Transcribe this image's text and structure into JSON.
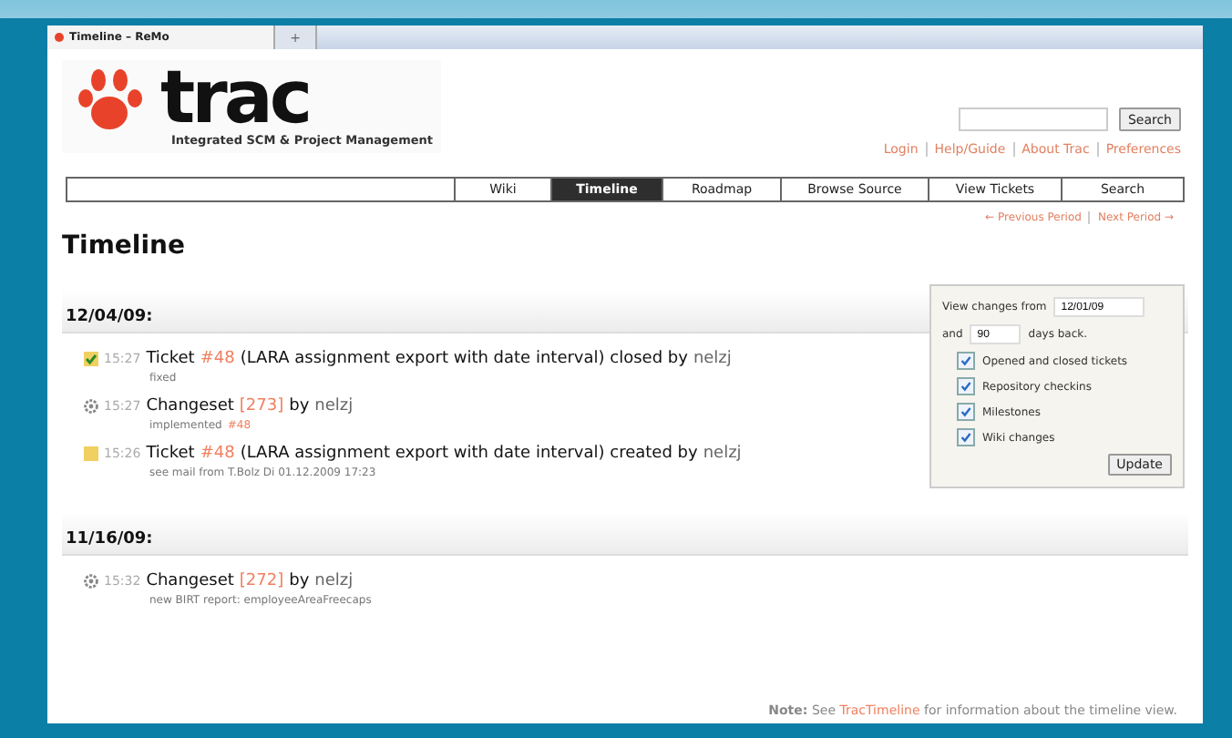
{
  "browser": {
    "tab_title": "Timeline – ReMo",
    "new_tab": "+"
  },
  "logo": {
    "name": "trac",
    "tagline": "Integrated SCM & Project Management"
  },
  "search": {
    "button": "Search"
  },
  "meta_nav": [
    "Login",
    "Help/Guide",
    "About Trac",
    "Preferences"
  ],
  "main_nav": [
    {
      "label": "Wiki",
      "selected": false
    },
    {
      "label": "Timeline",
      "selected": true
    },
    {
      "label": "Roadmap",
      "selected": false
    },
    {
      "label": "Browse Source",
      "selected": false
    },
    {
      "label": "View Tickets",
      "selected": false
    },
    {
      "label": "Search",
      "selected": false
    }
  ],
  "period_nav": {
    "previous": "← Previous Period",
    "next": "Next Period →"
  },
  "title": "Timeline",
  "days": [
    {
      "date": "12/04/09:",
      "events": [
        {
          "kind": "ticket-closed",
          "time": "15:27",
          "type_word": "Ticket",
          "ref": "#48",
          "summary": "(LARA assignment export with date interval) closed by",
          "author": "nelzj",
          "description": "fixed"
        },
        {
          "kind": "changeset",
          "time": "15:27",
          "type_word": "Changeset",
          "ref": "[273]",
          "summary": "by",
          "author": "nelzj",
          "description": "implemented",
          "description_ref": "#48"
        },
        {
          "kind": "ticket-created",
          "time": "15:26",
          "type_word": "Ticket",
          "ref": "#48",
          "summary": "(LARA assignment export with date interval) created by",
          "author": "nelzj",
          "description": "see mail from T.Bolz Di 01.12.2009 17:23"
        }
      ]
    },
    {
      "date": "11/16/09:",
      "events": [
        {
          "kind": "changeset",
          "time": "15:32",
          "type_word": "Changeset",
          "ref": "[272]",
          "summary": "by",
          "author": "nelzj",
          "description": "new BIRT report: employeeAreaFreecaps"
        }
      ]
    }
  ],
  "filters": {
    "from_label": "View changes from",
    "from_value": "12/01/09",
    "and_label": "and",
    "days_value": "90",
    "days_label": "days back.",
    "options": [
      {
        "label": "Opened and closed tickets",
        "checked": true
      },
      {
        "label": "Repository checkins",
        "checked": true
      },
      {
        "label": "Milestones",
        "checked": true
      },
      {
        "label": "Wiki changes",
        "checked": true
      }
    ],
    "update": "Update"
  },
  "note": {
    "label": "Note:",
    "before": "See",
    "link": "TracTimeline",
    "after": "for information about the timeline view."
  }
}
